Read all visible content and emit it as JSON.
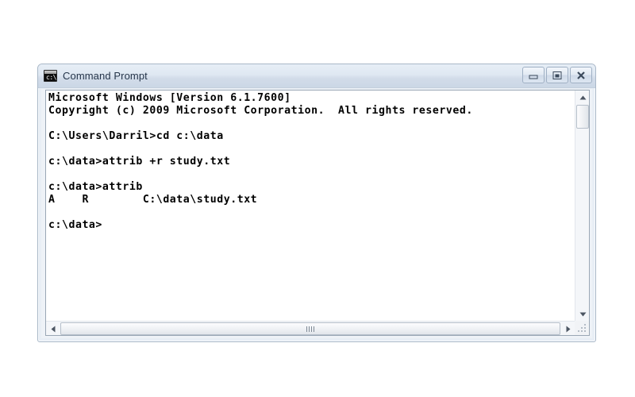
{
  "window": {
    "title": "Command Prompt",
    "icon_name": "command-prompt-icon",
    "icon_glyph": "c:\\",
    "controls": {
      "minimize_label": "Minimize",
      "maximize_label": "Maximize",
      "close_label": "Close"
    }
  },
  "console": {
    "background_color": "#ffffff",
    "text_color": "#000000",
    "lines": [
      "Microsoft Windows [Version 6.1.7600]",
      "Copyright (c) 2009 Microsoft Corporation.  All rights reserved.",
      "",
      "C:\\Users\\Darril>cd c:\\data",
      "",
      "c:\\data>attrib +r study.txt",
      "",
      "c:\\data>attrib",
      "A    R        C:\\data\\study.txt",
      "",
      "c:\\data>"
    ]
  },
  "scrollbars": {
    "vertical": {
      "up_arrow": "scroll-up",
      "down_arrow": "scroll-down"
    },
    "horizontal": {
      "left_arrow": "scroll-left",
      "right_arrow": "scroll-right"
    },
    "resize_grip": "resize-grip"
  }
}
